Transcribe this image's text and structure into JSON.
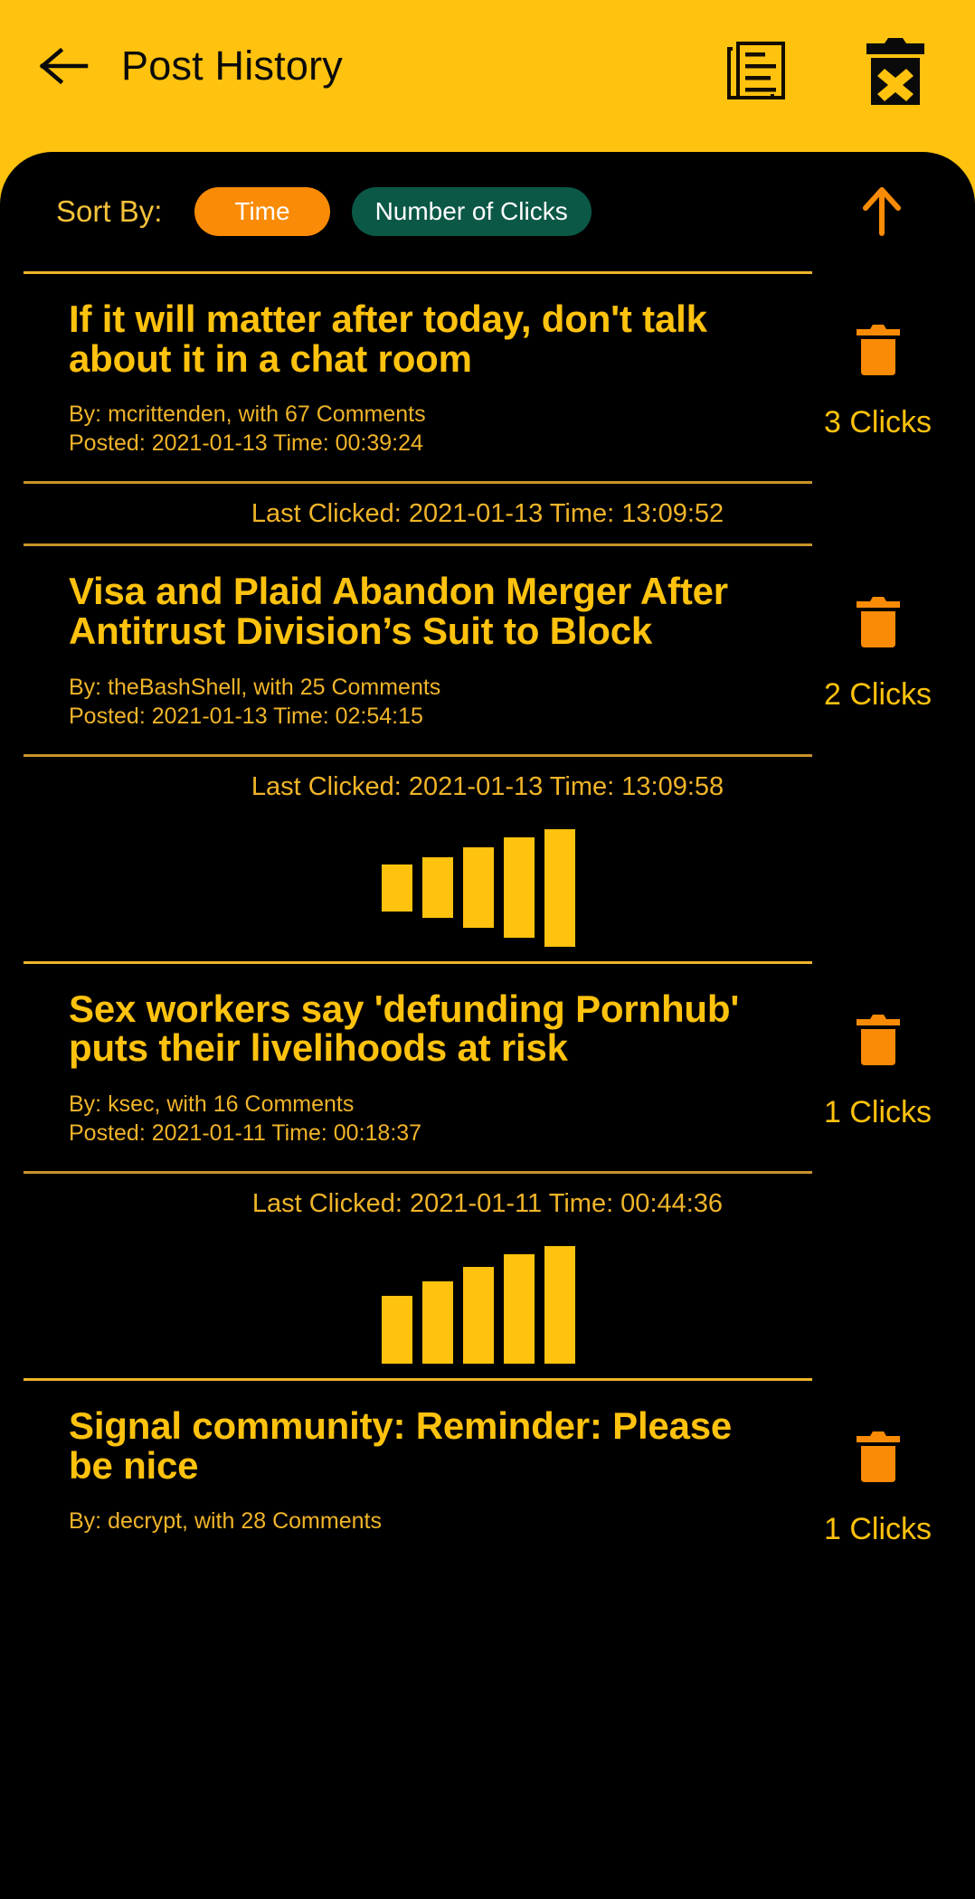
{
  "header": {
    "back_icon": "arrow-left-icon",
    "title": "Post History",
    "articles_icon": "document-list-icon",
    "clear_all_icon": "trash-x-icon"
  },
  "sort": {
    "label": "Sort By:",
    "options": [
      {
        "label": "Time",
        "selected": true,
        "color": "#F98B07"
      },
      {
        "label": "Number of Clicks",
        "selected": false,
        "color": "#0B5847"
      }
    ],
    "direction_icon": "arrow-up-icon",
    "direction": "ascending",
    "direction_color": "#F98B07"
  },
  "colors": {
    "brand_yellow": "#FFC20E",
    "amber_text": "#F0B429",
    "orange_accent": "#F98B07",
    "teal_chip": "#0B5847",
    "panel_black": "#000000"
  },
  "posts": [
    {
      "title": "If it will matter after today, don't talk about it in a chat room",
      "byline": "By: mcrittenden, with 67 Comments",
      "posted": "Posted: 2021-01-13 Time: 00:39:24",
      "clicks": "3 Clicks",
      "last_clicked": "Last Clicked: 2021-01-13 Time: 13:09:52",
      "delete_icon": "trash-icon",
      "chart": null
    },
    {
      "title": "Visa and Plaid Abandon Merger After Antitrust Division’s Suit to Block",
      "byline": "By: theBashShell, with 25 Comments",
      "posted": "Posted: 2021-01-13 Time: 02:54:15",
      "clicks": "2 Clicks",
      "last_clicked": "Last Clicked: 2021-01-13 Time: 13:09:58",
      "delete_icon": "trash-icon",
      "chart": {
        "style": "centered",
        "values": [
          40,
          52,
          68,
          85,
          100
        ]
      }
    },
    {
      "title": "Sex workers say 'defunding Pornhub' puts their livelihoods at risk",
      "byline": "By: ksec, with 16 Comments",
      "posted": "Posted: 2021-01-11 Time: 00:18:37",
      "clicks": "1 Clicks",
      "last_clicked": "Last Clicked: 2021-01-11 Time: 00:44:36",
      "delete_icon": "trash-icon",
      "chart": {
        "style": "bottom",
        "values": [
          58,
          70,
          82,
          93,
          100
        ]
      }
    },
    {
      "title": "Signal community: Reminder: Please be nice",
      "byline": "By: decrypt, with 28 Comments",
      "posted": "",
      "clicks": "1 Clicks",
      "last_clicked": "",
      "delete_icon": "trash-icon",
      "chart": null
    }
  ]
}
